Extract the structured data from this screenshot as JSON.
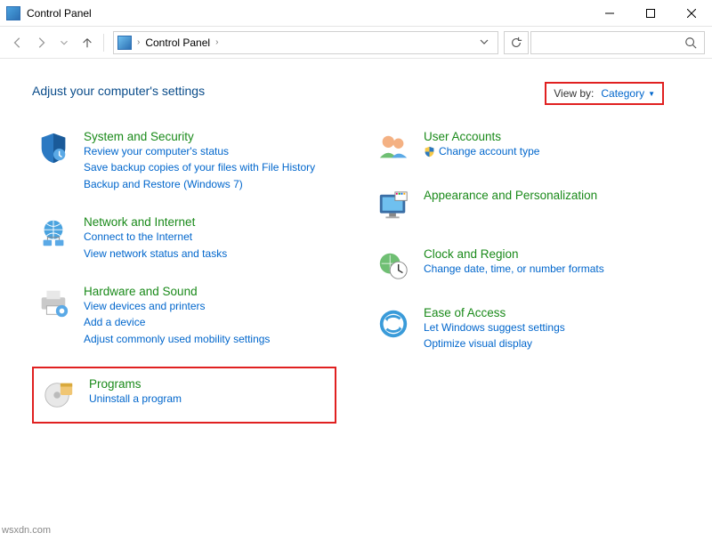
{
  "window": {
    "title": "Control Panel"
  },
  "address": {
    "location": "Control Panel",
    "sep": "›"
  },
  "content": {
    "heading": "Adjust your computer's settings",
    "viewby_label": "View by:",
    "viewby_value": "Category"
  },
  "left": [
    {
      "title": "System and Security",
      "links": [
        "Review your computer's status",
        "Save backup copies of your files with File History",
        "Backup and Restore (Windows 7)"
      ]
    },
    {
      "title": "Network and Internet",
      "links": [
        "Connect to the Internet",
        "View network status and tasks"
      ]
    },
    {
      "title": "Hardware and Sound",
      "links": [
        "View devices and printers",
        "Add a device",
        "Adjust commonly used mobility settings"
      ]
    },
    {
      "title": "Programs",
      "links": [
        "Uninstall a program"
      ]
    }
  ],
  "right": [
    {
      "title": "User Accounts",
      "links": [
        "Change account type"
      ],
      "shield": true
    },
    {
      "title": "Appearance and Personalization",
      "links": []
    },
    {
      "title": "Clock and Region",
      "links": [
        "Change date, time, or number formats"
      ]
    },
    {
      "title": "Ease of Access",
      "links": [
        "Let Windows suggest settings",
        "Optimize visual display"
      ]
    }
  ],
  "watermark": "wsxdn.com"
}
